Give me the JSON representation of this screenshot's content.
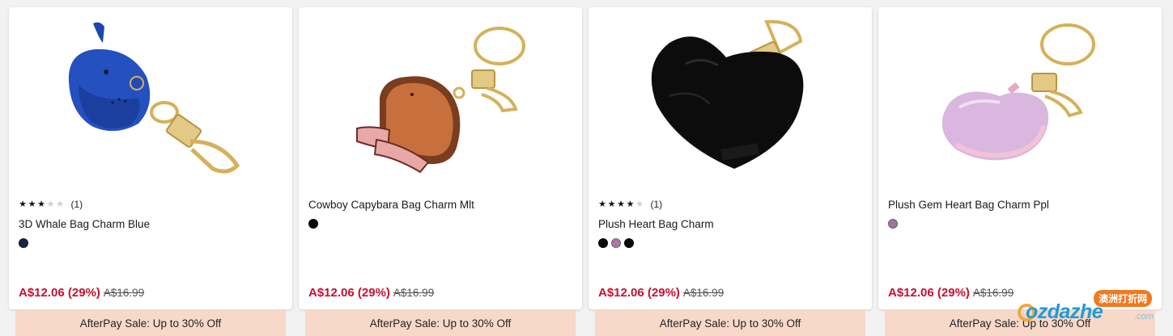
{
  "products": [
    {
      "name": "3D Whale Bag Charm Blue",
      "rating": 3,
      "rating_max": 5,
      "review_count": "(1)",
      "show_rating": true,
      "colors": [
        "#1b2340"
      ],
      "sale_price": "A$12.06",
      "discount": "(29%)",
      "original_price": "A$16.99",
      "image_icon": "whale-charm-icon",
      "promo": "AfterPay Sale: Up to 30% Off"
    },
    {
      "name": "Cowboy Capybara Bag Charm Mlt",
      "rating": 0,
      "rating_max": 5,
      "review_count": "",
      "show_rating": false,
      "colors": [
        "#0a0a0a"
      ],
      "sale_price": "A$12.06",
      "discount": "(29%)",
      "original_price": "A$16.99",
      "image_icon": "capybara-charm-icon",
      "promo": "AfterPay Sale: Up to 30% Off"
    },
    {
      "name": "Plush Heart Bag Charm",
      "rating": 4,
      "rating_max": 5,
      "review_count": "(1)",
      "show_rating": true,
      "colors": [
        "#0a0a0a",
        "#a87aa0",
        "#0a0a0a"
      ],
      "sale_price": "A$12.06",
      "discount": "(29%)",
      "original_price": "A$16.99",
      "image_icon": "plush-heart-charm-icon",
      "promo": "AfterPay Sale: Up to 30% Off"
    },
    {
      "name": "Plush Gem Heart Bag Charm Ppl",
      "rating": 0,
      "rating_max": 5,
      "review_count": "",
      "show_rating": false,
      "colors": [
        "#a07598"
      ],
      "sale_price": "A$12.06",
      "discount": "(29%)",
      "original_price": "A$16.99",
      "image_icon": "gem-heart-charm-icon",
      "promo": "AfterPay Sale: Up to 30% Off"
    }
  ],
  "theme": {
    "sale_color": "#c8102e",
    "promo_bg": "#f8d8c9"
  },
  "watermark": {
    "brand": "ozdazhe",
    "suffix": ".com",
    "chinese": "澳洲打折网"
  }
}
